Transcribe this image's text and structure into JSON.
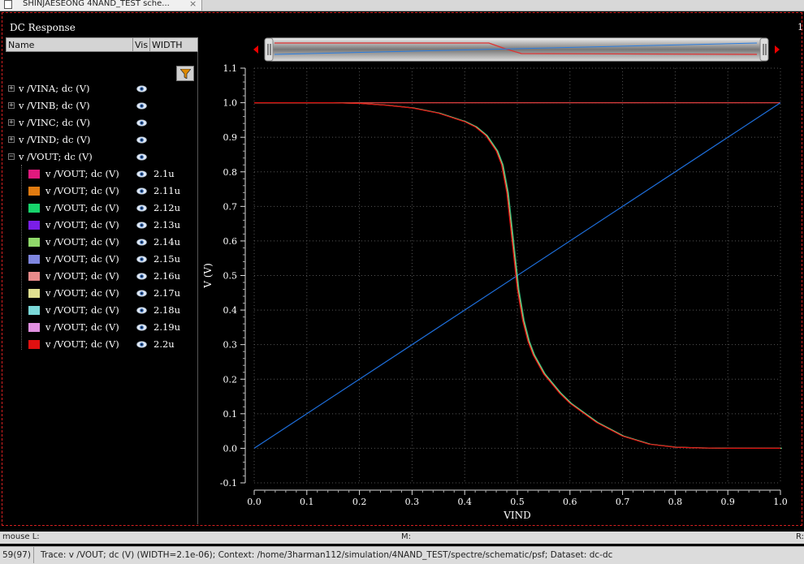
{
  "window": {
    "tab_title": "SHINJAESEONG 4NAND_TEST sche...",
    "close_glyph": "×"
  },
  "panel": {
    "title": "DC Response",
    "right_edge_label": "1"
  },
  "tree": {
    "headers": {
      "name": "Name",
      "vis": "Vis",
      "width": "WIDTH"
    },
    "signals": [
      {
        "label": "v /VINA; dc (V)",
        "expander": "+"
      },
      {
        "label": "v /VINB; dc (V)",
        "expander": "+"
      },
      {
        "label": "v /VINC; dc (V)",
        "expander": "+"
      },
      {
        "label": "v /VIND; dc (V)",
        "expander": "+"
      },
      {
        "label": "v /VOUT; dc (V)",
        "expander": "−"
      }
    ],
    "sweep_children": [
      {
        "label": "v /VOUT; dc (V)",
        "width": "2.1u",
        "color": "#e0197d"
      },
      {
        "label": "v /VOUT; dc (V)",
        "width": "2.11u",
        "color": "#e07a10"
      },
      {
        "label": "v /VOUT; dc (V)",
        "width": "2.12u",
        "color": "#17d36b"
      },
      {
        "label": "v /VOUT; dc (V)",
        "width": "2.13u",
        "color": "#7a1ee8"
      },
      {
        "label": "v /VOUT; dc (V)",
        "width": "2.14u",
        "color": "#8fd86a"
      },
      {
        "label": "v /VOUT; dc (V)",
        "width": "2.15u",
        "color": "#7f86e0"
      },
      {
        "label": "v /VOUT; dc (V)",
        "width": "2.16u",
        "color": "#e88a8a"
      },
      {
        "label": "v /VOUT; dc (V)",
        "width": "2.17u",
        "color": "#e0e090"
      },
      {
        "label": "v /VOUT; dc (V)",
        "width": "2.18u",
        "color": "#7ad8d8"
      },
      {
        "label": "v /VOUT; dc (V)",
        "width": "2.19u",
        "color": "#e090e0"
      },
      {
        "label": "v /VOUT; dc (V)",
        "width": "2.2u",
        "color": "#e01010"
      }
    ]
  },
  "chart_data": {
    "type": "line",
    "xlabel": "VIND",
    "ylabel": "V (V)",
    "xlim": [
      0.0,
      1.0
    ],
    "ylim": [
      -0.1,
      1.1
    ],
    "xticks": [
      "0.0",
      "0.1",
      "0.2",
      "0.3",
      "0.4",
      "0.5",
      "0.6",
      "0.7",
      "0.8",
      "0.9",
      "1.0"
    ],
    "yticks": [
      "-0.1",
      "0.0",
      "0.1",
      "0.2",
      "0.3",
      "0.4",
      "0.5",
      "0.6",
      "0.7",
      "0.8",
      "0.9",
      "1.0",
      "1.1"
    ],
    "grid": true,
    "series": [
      {
        "color": "#e04040",
        "x": [
          0.0,
          1.0
        ],
        "y": [
          1.0,
          1.0
        ]
      },
      {
        "color": "#1e6fdc",
        "x": [
          0.0,
          1.0
        ],
        "y": [
          0.0,
          1.0
        ]
      },
      {
        "color": "#e01010",
        "x": [
          0.0,
          0.15,
          0.2,
          0.25,
          0.3,
          0.35,
          0.4,
          0.42,
          0.44,
          0.46,
          0.47,
          0.48,
          0.49,
          0.5,
          0.51,
          0.52,
          0.53,
          0.55,
          0.58,
          0.6,
          0.65,
          0.7,
          0.75,
          0.8,
          0.85,
          0.9,
          1.0
        ],
        "y": [
          1.0,
          1.0,
          0.998,
          0.993,
          0.985,
          0.97,
          0.945,
          0.93,
          0.905,
          0.86,
          0.82,
          0.74,
          0.6,
          0.46,
          0.37,
          0.31,
          0.27,
          0.215,
          0.16,
          0.13,
          0.075,
          0.035,
          0.012,
          0.003,
          0.001,
          0.0,
          0.0
        ]
      }
    ]
  },
  "status": {
    "mouse_label": "mouse L:",
    "m_label": "M:",
    "r_label": "R:",
    "counter": "59(97)",
    "message": "Trace: v /VOUT; dc (V) (WIDTH=2.1e-06); Context: /home/3harman112/simulation/4NAND_TEST/spectre/schematic/psf; Dataset: dc-dc"
  }
}
